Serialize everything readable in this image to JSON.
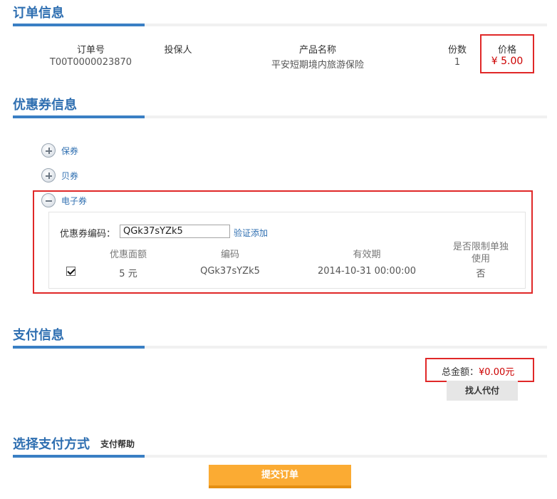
{
  "order": {
    "title": "订单信息",
    "columns": [
      {
        "header": "订单号",
        "value": "T00T0000023870"
      },
      {
        "header": "投保人",
        "value": ""
      },
      {
        "header": "产品名称",
        "value": "平安短期境内旅游保险"
      },
      {
        "header": "份数",
        "value": "1"
      },
      {
        "header": "价格",
        "value": "¥ 5.00"
      }
    ]
  },
  "coupon": {
    "title": "优惠券信息",
    "types": [
      {
        "label": "保券",
        "expanded": false
      },
      {
        "label": "贝券",
        "expanded": false
      },
      {
        "label": "电子券",
        "expanded": true
      }
    ],
    "code_label": "优惠券编码：",
    "code_value": "QGk37sYZk5",
    "verify_link": "验证添加",
    "table": {
      "headers": [
        "优惠面额",
        "编码",
        "有效期",
        "是否限制单独使用"
      ],
      "row": {
        "checked": true,
        "amount": "5 元",
        "code": "QGk37sYZk5",
        "expiry": "2014-10-31 00:00:00",
        "exclusive": "否"
      }
    }
  },
  "payment": {
    "title": "支付信息",
    "total_label": "总金额：",
    "total_value": "¥0.00元",
    "proxy_button": "找人代付"
  },
  "pay_method": {
    "title": "选择支付方式",
    "help_link": "支付帮助"
  },
  "submit_button": "提交订单",
  "colors": {
    "accent": "#3a7fc4",
    "title": "#2f6fb1",
    "price": "#cc0000",
    "highlight_border": "#e02828",
    "submit": "#fbab33"
  }
}
